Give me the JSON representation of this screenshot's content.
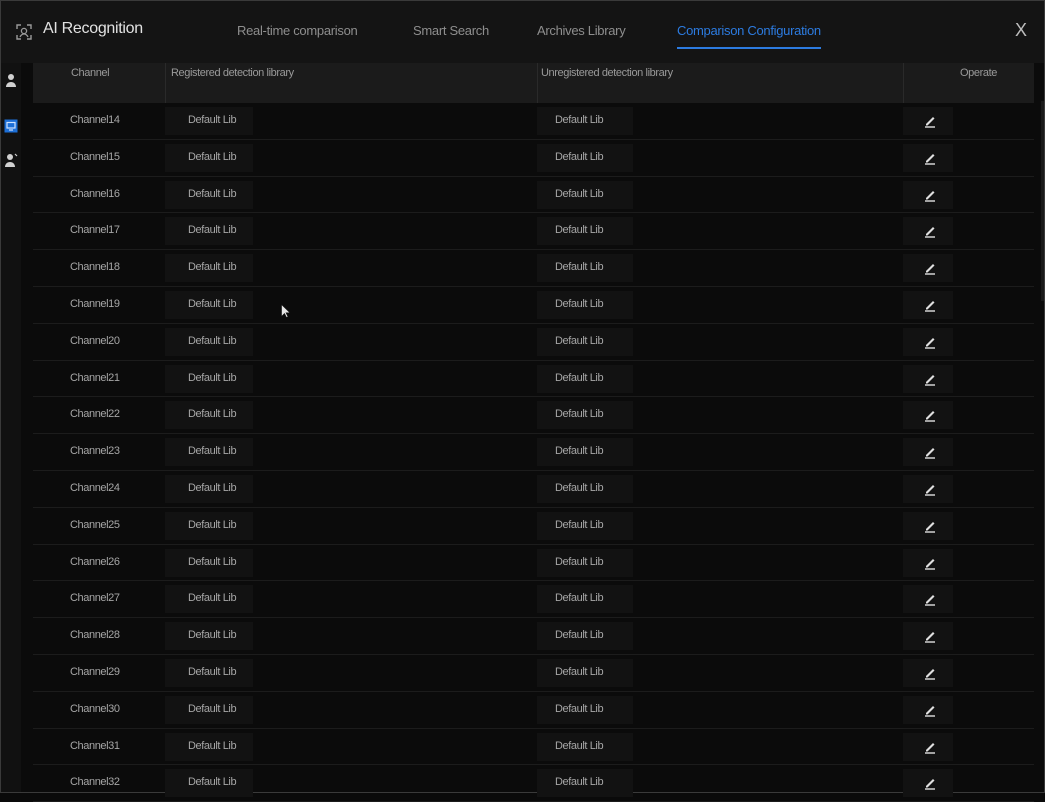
{
  "app": {
    "title": "AI Recognition",
    "logo_icon": "ai-face-icon"
  },
  "tabs": [
    {
      "label": "Real-time comparison",
      "active": false
    },
    {
      "label": "Smart Search",
      "active": false
    },
    {
      "label": "Archives Library",
      "active": false
    },
    {
      "label": "Comparison Configuration",
      "active": true
    }
  ],
  "close_label": "X",
  "rail_icons": [
    "person-icon",
    "monitor-icon",
    "person-tag-icon"
  ],
  "table": {
    "headers": {
      "channel": "Channel",
      "registered": "Registered detection library",
      "unregistered": "Unregistered detection library",
      "operate": "Operate"
    },
    "rows": [
      {
        "channel": "Channel14",
        "registered": "Default Lib",
        "unregistered": "Default Lib"
      },
      {
        "channel": "Channel15",
        "registered": "Default Lib",
        "unregistered": "Default Lib"
      },
      {
        "channel": "Channel16",
        "registered": "Default Lib",
        "unregistered": "Default Lib"
      },
      {
        "channel": "Channel17",
        "registered": "Default Lib",
        "unregistered": "Default Lib"
      },
      {
        "channel": "Channel18",
        "registered": "Default Lib",
        "unregistered": "Default Lib"
      },
      {
        "channel": "Channel19",
        "registered": "Default Lib",
        "unregistered": "Default Lib"
      },
      {
        "channel": "Channel20",
        "registered": "Default Lib",
        "unregistered": "Default Lib"
      },
      {
        "channel": "Channel21",
        "registered": "Default Lib",
        "unregistered": "Default Lib"
      },
      {
        "channel": "Channel22",
        "registered": "Default Lib",
        "unregistered": "Default Lib"
      },
      {
        "channel": "Channel23",
        "registered": "Default Lib",
        "unregistered": "Default Lib"
      },
      {
        "channel": "Channel24",
        "registered": "Default Lib",
        "unregistered": "Default Lib"
      },
      {
        "channel": "Channel25",
        "registered": "Default Lib",
        "unregistered": "Default Lib"
      },
      {
        "channel": "Channel26",
        "registered": "Default Lib",
        "unregistered": "Default Lib"
      },
      {
        "channel": "Channel27",
        "registered": "Default Lib",
        "unregistered": "Default Lib"
      },
      {
        "channel": "Channel28",
        "registered": "Default Lib",
        "unregistered": "Default Lib"
      },
      {
        "channel": "Channel29",
        "registered": "Default Lib",
        "unregistered": "Default Lib"
      },
      {
        "channel": "Channel30",
        "registered": "Default Lib",
        "unregistered": "Default Lib"
      },
      {
        "channel": "Channel31",
        "registered": "Default Lib",
        "unregistered": "Default Lib"
      },
      {
        "channel": "Channel32",
        "registered": "Default Lib",
        "unregistered": "Default Lib"
      }
    ]
  },
  "colors": {
    "accent": "#2c7be0",
    "background": "#0b0b0b",
    "header_bg": "#1b1b1b",
    "text": "#a6a6a6"
  }
}
